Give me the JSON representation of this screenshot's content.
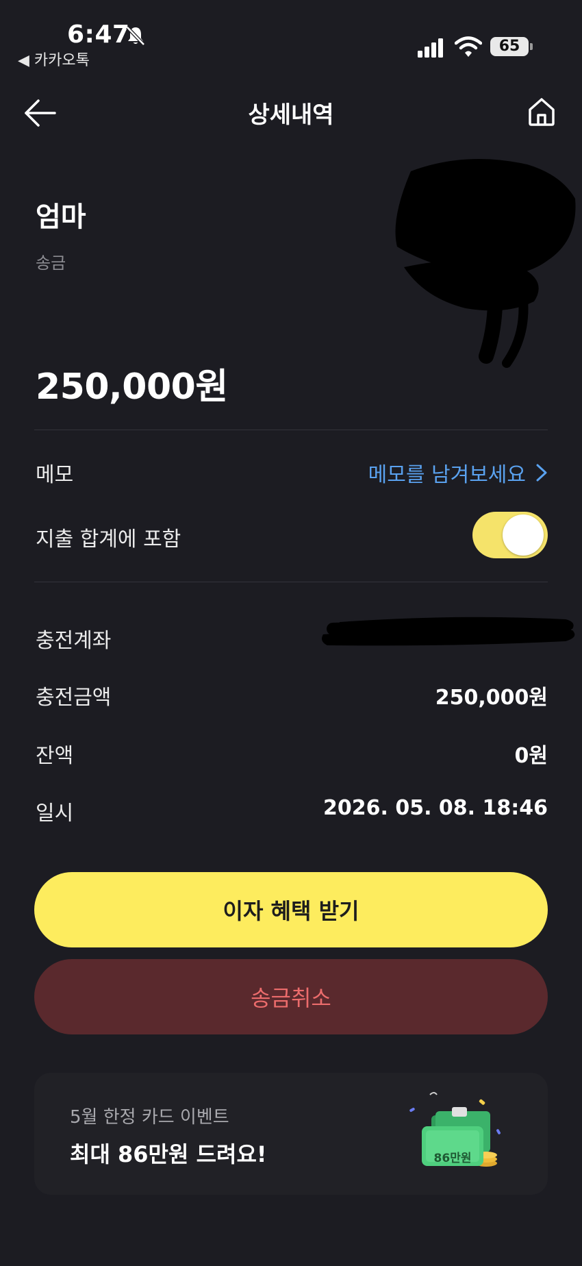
{
  "status_bar": {
    "time": "6:47",
    "back_app": "◀ 카카오톡",
    "battery": "65"
  },
  "header": {
    "title": "상세내역"
  },
  "transaction": {
    "recipient": "엄마",
    "type": "송금",
    "amount": "250,000원"
  },
  "memo": {
    "label": "메모",
    "placeholder": "메모를 남겨보세요"
  },
  "expense_toggle": {
    "label": "지출 합계에 포함",
    "on": true
  },
  "details": {
    "account_label": "충전계좌",
    "charge_label": "충전금액",
    "charge_value": "250,000원",
    "balance_label": "잔액",
    "balance_value": "0원",
    "datetime_label": "일시",
    "datetime_value": "2026. 05. 08. 18:46"
  },
  "buttons": {
    "interest": "이자 혜택 받기",
    "cancel": "송금취소"
  },
  "promo": {
    "subtitle": "5월 한정 카드 이벤트",
    "title": "최대 86만원 드려요!",
    "badge": "86만원"
  },
  "colors": {
    "background": "#1c1c22",
    "accent_yellow": "#fdec5e",
    "link_blue": "#5aa2f0",
    "cancel_bg": "#5a292d",
    "cancel_text": "#ec6c6c"
  }
}
